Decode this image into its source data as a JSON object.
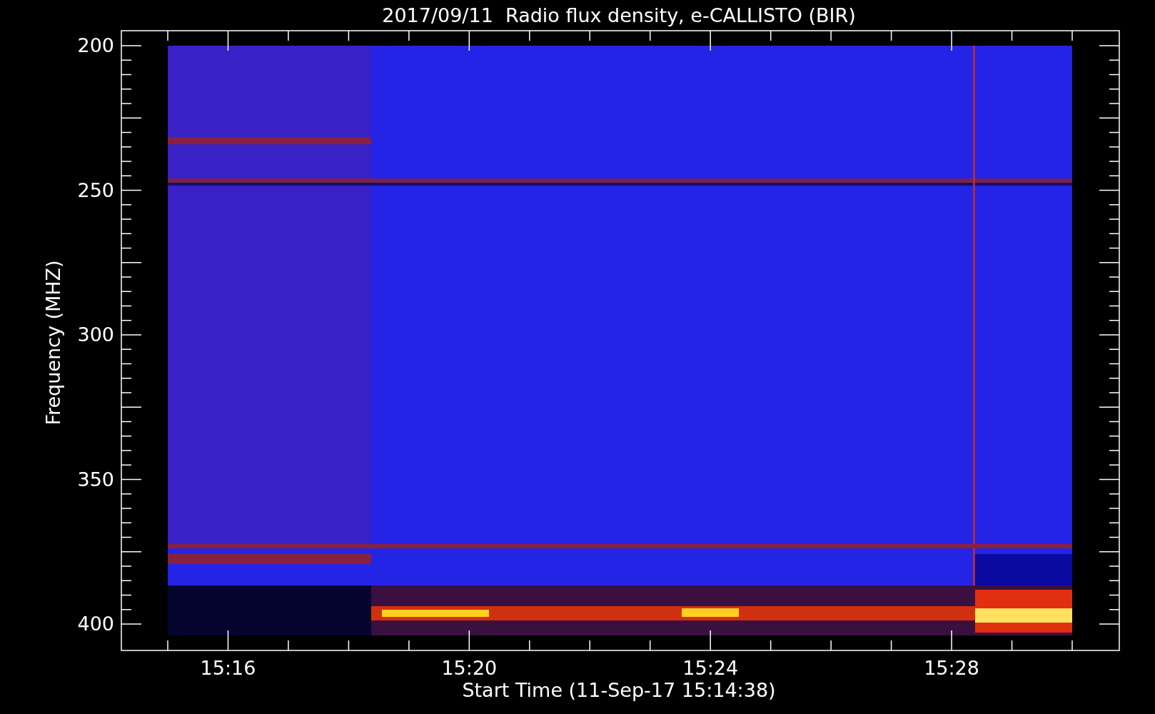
{
  "title": "2017/09/11  Radio flux density, e-CALLISTO (BIR)",
  "y_axis": {
    "label": "Frequency (MHZ)",
    "ticks": [
      "200",
      "250",
      "300",
      "350",
      "400"
    ]
  },
  "x_axis": {
    "label": "Start Time (11-Sep-17 15:14:38)",
    "ticks": [
      "15:16",
      "15:20",
      "15:24",
      "15:28"
    ]
  }
}
